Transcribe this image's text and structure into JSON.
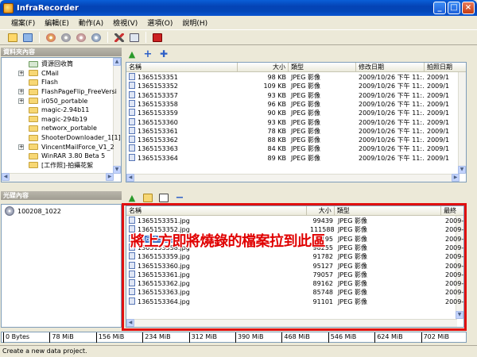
{
  "window": {
    "title": "InfraRecorder",
    "buttons": {
      "minimize": "_",
      "maximize": "□",
      "close": "×"
    }
  },
  "menu": [
    "檔案(F)",
    "編輯(E)",
    "動作(A)",
    "檢視(V)",
    "選項(O)",
    "說明(H)"
  ],
  "toolbar_icons": [
    "new-project-icon",
    "open-icon",
    "burn-image-icon",
    "copy-disc-icon",
    "erase-disc-icon",
    "disc-info-icon",
    "tools-icon",
    "log-icon",
    "exit-icon"
  ],
  "explorer": {
    "tree_header": "資料夾內容",
    "tree_items": [
      {
        "label": "資源回收筒",
        "icon": "recycle-bin-icon",
        "expandable": false
      },
      {
        "label": "CMail",
        "icon": "folder-icon",
        "expandable": true
      },
      {
        "label": "Flash",
        "icon": "folder-icon",
        "expandable": false
      },
      {
        "label": "FlashPageFlip_FreeVersi",
        "icon": "folder-icon",
        "expandable": true
      },
      {
        "label": "ir050_portable",
        "icon": "folder-icon",
        "expandable": true
      },
      {
        "label": "magic-2.94b11",
        "icon": "folder-icon",
        "expandable": false
      },
      {
        "label": "magic-294b19",
        "icon": "folder-icon",
        "expandable": false
      },
      {
        "label": "networx_portable",
        "icon": "folder-icon",
        "expandable": false
      },
      {
        "label": "ShooterDownloader_1[1]",
        "icon": "folder-icon",
        "expandable": false
      },
      {
        "label": "VincentMailForce_V1_2",
        "icon": "folder-icon",
        "expandable": true
      },
      {
        "label": "WinRAR 3.80 Beta 5",
        "icon": "folder-icon",
        "expandable": false
      },
      {
        "label": "[工作照]-拍攝花絮",
        "icon": "folder-icon",
        "expandable": false
      }
    ],
    "columns": [
      "名稱",
      "大小",
      "類型",
      "修改日期",
      "拍照日期"
    ],
    "files": [
      {
        "name": "1365153351",
        "size": "98 KB",
        "type": "JPEG 影像",
        "modified": "2009/10/26 下午 11:...",
        "taken": "2009/1"
      },
      {
        "name": "1365153352",
        "size": "109 KB",
        "type": "JPEG 影像",
        "modified": "2009/10/26 下午 11:...",
        "taken": "2009/1"
      },
      {
        "name": "1365153357",
        "size": "93 KB",
        "type": "JPEG 影像",
        "modified": "2009/10/26 下午 11:...",
        "taken": "2009/1"
      },
      {
        "name": "1365153358",
        "size": "96 KB",
        "type": "JPEG 影像",
        "modified": "2009/10/26 下午 11:...",
        "taken": "2009/1"
      },
      {
        "name": "1365153359",
        "size": "90 KB",
        "type": "JPEG 影像",
        "modified": "2009/10/26 下午 11:...",
        "taken": "2009/1"
      },
      {
        "name": "1365153360",
        "size": "93 KB",
        "type": "JPEG 影像",
        "modified": "2009/10/26 下午 11:...",
        "taken": "2009/1"
      },
      {
        "name": "1365153361",
        "size": "78 KB",
        "type": "JPEG 影像",
        "modified": "2009/10/26 下午 11:...",
        "taken": "2009/1"
      },
      {
        "name": "1365153362",
        "size": "88 KB",
        "type": "JPEG 影像",
        "modified": "2009/10/26 下午 11:...",
        "taken": "2009/1"
      },
      {
        "name": "1365153363",
        "size": "84 KB",
        "type": "JPEG 影像",
        "modified": "2009/10/26 下午 11:...",
        "taken": "2009/1"
      },
      {
        "name": "1365153364",
        "size": "89 KB",
        "type": "JPEG 影像",
        "modified": "2009/10/26 下午 11:...",
        "taken": "2009/1"
      }
    ]
  },
  "disc": {
    "header": "光碟內容",
    "root_label": "100208_1022",
    "columns": [
      "名稱",
      "大小",
      "類型",
      "最終"
    ],
    "files": [
      {
        "name": "1365153351.jpg",
        "size": "99439",
        "type": "JPEG 影像",
        "date": "2009-1"
      },
      {
        "name": "1365153352.jpg",
        "size": "111588",
        "type": "JPEG 影像",
        "date": "2009-1"
      },
      {
        "name": "1365153357.jpg",
        "size": "95195",
        "type": "JPEG 影像",
        "date": "2009-1"
      },
      {
        "name": "1365153358.jpg",
        "size": "98255",
        "type": "JPEG 影像",
        "date": "2009-1"
      },
      {
        "name": "1365153359.jpg",
        "size": "91782",
        "type": "JPEG 影像",
        "date": "2009-1"
      },
      {
        "name": "1365153360.jpg",
        "size": "95127",
        "type": "JPEG 影像",
        "date": "2009-1"
      },
      {
        "name": "1365153361.jpg",
        "size": "79057",
        "type": "JPEG 影像",
        "date": "2009-1"
      },
      {
        "name": "1365153362.jpg",
        "size": "89162",
        "type": "JPEG 影像",
        "date": "2009-1"
      },
      {
        "name": "1365153363.jpg",
        "size": "85748",
        "type": "JPEG 影像",
        "date": "2009-1"
      },
      {
        "name": "1365153364.jpg",
        "size": "91101",
        "type": "JPEG 影像",
        "date": "2009-1"
      }
    ],
    "selected_index": 2,
    "overlay_text": "將上方即將燒錄的檔案拉到此區"
  },
  "space_meter": {
    "labels": [
      "0 Bytes",
      "78 MiB",
      "156 MiB",
      "234 MiB",
      "312 MiB",
      "390 MiB",
      "468 MiB",
      "546 MiB",
      "624 MiB",
      "702 MiB"
    ],
    "used_fraction": 0.0
  },
  "status": "Create a new data project.",
  "colors": {
    "highlight_box": "#e01010",
    "overlay_text": "#e00000",
    "selection": "#316ac5"
  }
}
